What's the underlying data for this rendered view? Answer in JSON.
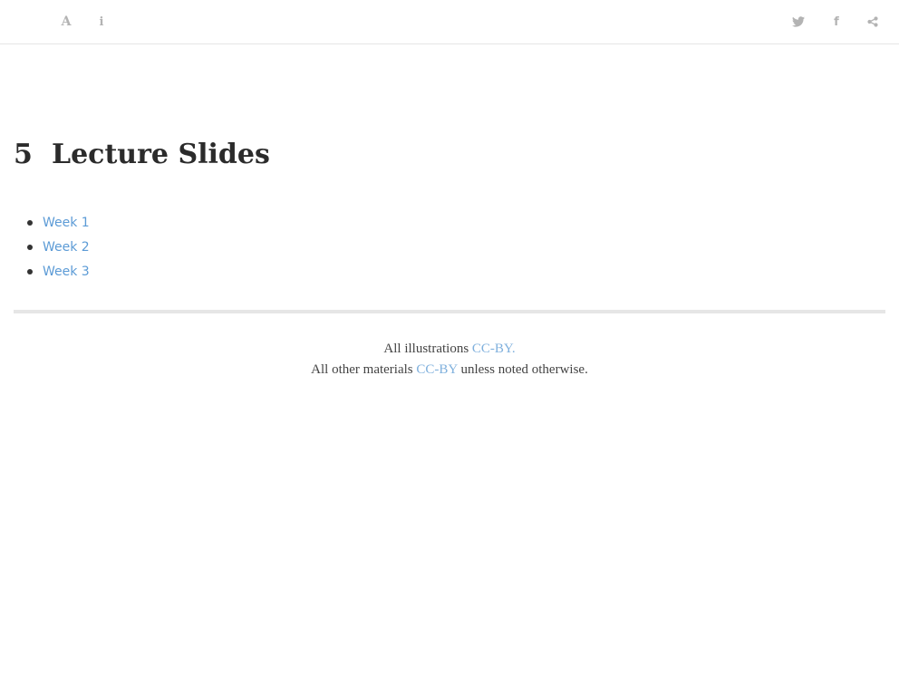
{
  "toolbar": {
    "left_icons": [
      "font-settings-icon",
      "info-icon"
    ],
    "right_icons": [
      "twitter-icon",
      "facebook-icon",
      "share-icon"
    ]
  },
  "chapter": {
    "number": "5",
    "title": "Lecture Slides"
  },
  "slides": [
    {
      "label": "Week 1"
    },
    {
      "label": "Week 2"
    },
    {
      "label": "Week 3"
    }
  ],
  "footer": {
    "line1_prefix": "All illustrations ",
    "line1_link": "CC-BY.",
    "line2_prefix": "All other materials ",
    "line2_link": "CC-BY",
    "line2_suffix": " unless noted otherwise."
  },
  "colors": {
    "link": "#5c9bd6",
    "footer_link": "#7fb0dd",
    "icon": "#b3b3b3",
    "divider": "#e6e6e6"
  }
}
